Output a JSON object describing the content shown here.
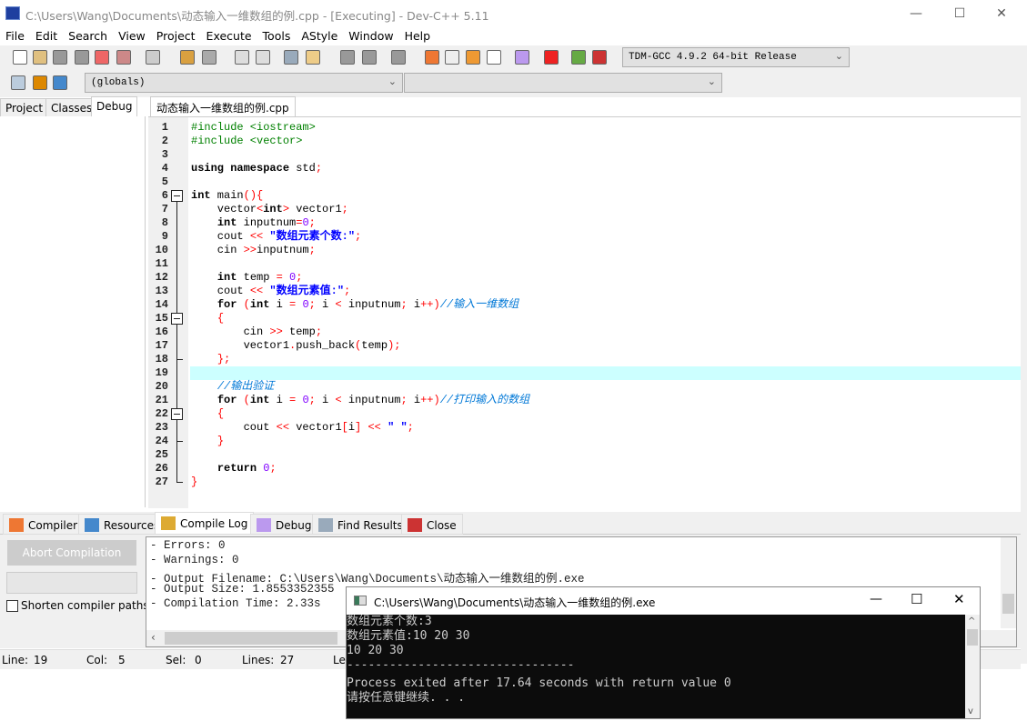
{
  "window": {
    "title": "C:\\Users\\Wang\\Documents\\动态输入一维数组的例.cpp - [Executing] - Dev-C++ 5.11",
    "minimize": "—",
    "maximize": "☐",
    "close": "✕"
  },
  "menu": [
    "File",
    "Edit",
    "Search",
    "View",
    "Project",
    "Execute",
    "Tools",
    "AStyle",
    "Window",
    "Help"
  ],
  "toolbar": {
    "compiler_select": "TDM-GCC 4.9.2 64-bit Release",
    "scope_select": "(globals)",
    "member_select": ""
  },
  "left_tabs": [
    "Project",
    "Classes",
    "Debug"
  ],
  "left_active": "Debug",
  "file_tab": "动态输入一维数组的例.cpp",
  "editor": {
    "current_line": 19,
    "fold_lines": [
      6,
      15,
      22
    ],
    "lines": [
      [
        [
          "#include <iostream>",
          "pp"
        ]
      ],
      [
        [
          "#include <vector>",
          "pp"
        ]
      ],
      [],
      [
        [
          "using namespace",
          "kw"
        ],
        [
          " std",
          "id"
        ],
        [
          ";",
          "sy"
        ]
      ],
      [],
      [
        [
          "int",
          "kw"
        ],
        [
          " main",
          "id"
        ],
        [
          "(){",
          "sy"
        ]
      ],
      [
        [
          "    vector",
          "id"
        ],
        [
          "<",
          "sy"
        ],
        [
          "int",
          "kw"
        ],
        [
          ">",
          "sy"
        ],
        [
          " vector1",
          "id"
        ],
        [
          ";",
          "sy"
        ]
      ],
      [
        [
          "    ",
          "id"
        ],
        [
          "int",
          "kw"
        ],
        [
          " inputnum",
          "id"
        ],
        [
          "=",
          "sy"
        ],
        [
          "0",
          "nu"
        ],
        [
          ";",
          "sy"
        ]
      ],
      [
        [
          "    cout ",
          "id"
        ],
        [
          "<<",
          "sy"
        ],
        [
          " ",
          "id"
        ],
        [
          "\"数组元素个数:\"",
          "st"
        ],
        [
          ";",
          "sy"
        ]
      ],
      [
        [
          "    cin ",
          "id"
        ],
        [
          ">>",
          "sy"
        ],
        [
          "inputnum",
          "id"
        ],
        [
          ";",
          "sy"
        ]
      ],
      [],
      [
        [
          "    ",
          "id"
        ],
        [
          "int",
          "kw"
        ],
        [
          " temp ",
          "id"
        ],
        [
          "=",
          "sy"
        ],
        [
          " ",
          "id"
        ],
        [
          "0",
          "nu"
        ],
        [
          ";",
          "sy"
        ]
      ],
      [
        [
          "    cout ",
          "id"
        ],
        [
          "<<",
          "sy"
        ],
        [
          " ",
          "id"
        ],
        [
          "\"数组元素值:\"",
          "st"
        ],
        [
          ";",
          "sy"
        ]
      ],
      [
        [
          "    ",
          "id"
        ],
        [
          "for",
          "kw"
        ],
        [
          " ",
          "id"
        ],
        [
          "(",
          "sy"
        ],
        [
          "int",
          "kw"
        ],
        [
          " i ",
          "id"
        ],
        [
          "=",
          "sy"
        ],
        [
          " ",
          "id"
        ],
        [
          "0",
          "nu"
        ],
        [
          ";",
          "sy"
        ],
        [
          " i ",
          "id"
        ],
        [
          "<",
          "sy"
        ],
        [
          " inputnum",
          "id"
        ],
        [
          ";",
          "sy"
        ],
        [
          " i",
          "id"
        ],
        [
          "++)",
          "sy"
        ],
        [
          "//输入一维数组",
          "cm"
        ]
      ],
      [
        [
          "    ",
          "id"
        ],
        [
          "{",
          "sy"
        ]
      ],
      [
        [
          "        cin ",
          "id"
        ],
        [
          ">>",
          "sy"
        ],
        [
          " temp",
          "id"
        ],
        [
          ";",
          "sy"
        ]
      ],
      [
        [
          "        vector1",
          "id"
        ],
        [
          ".",
          "sy"
        ],
        [
          "push_back",
          "id"
        ],
        [
          "(",
          "sy"
        ],
        [
          "temp",
          "id"
        ],
        [
          ");",
          "sy"
        ]
      ],
      [
        [
          "    ",
          "id"
        ],
        [
          "};",
          "sy"
        ]
      ],
      [],
      [
        [
          "    ",
          "id"
        ],
        [
          "//输出验证",
          "cm"
        ]
      ],
      [
        [
          "    ",
          "id"
        ],
        [
          "for",
          "kw"
        ],
        [
          " ",
          "id"
        ],
        [
          "(",
          "sy"
        ],
        [
          "int",
          "kw"
        ],
        [
          " i ",
          "id"
        ],
        [
          "=",
          "sy"
        ],
        [
          " ",
          "id"
        ],
        [
          "0",
          "nu"
        ],
        [
          ";",
          "sy"
        ],
        [
          " i ",
          "id"
        ],
        [
          "<",
          "sy"
        ],
        [
          " inputnum",
          "id"
        ],
        [
          ";",
          "sy"
        ],
        [
          " i",
          "id"
        ],
        [
          "++)",
          "sy"
        ],
        [
          "//打印输入的数组",
          "cm"
        ]
      ],
      [
        [
          "    ",
          "id"
        ],
        [
          "{",
          "sy"
        ]
      ],
      [
        [
          "        cout ",
          "id"
        ],
        [
          "<<",
          "sy"
        ],
        [
          " vector1",
          "id"
        ],
        [
          "[",
          "sy"
        ],
        [
          "i",
          "id"
        ],
        [
          "]",
          "sy"
        ],
        [
          " ",
          "id"
        ],
        [
          "<<",
          "sy"
        ],
        [
          " ",
          "id"
        ],
        [
          "\" \"",
          "st"
        ],
        [
          ";",
          "sy"
        ]
      ],
      [
        [
          "    ",
          "id"
        ],
        [
          "}",
          "sy"
        ]
      ],
      [],
      [
        [
          "    ",
          "id"
        ],
        [
          "return",
          "kw"
        ],
        [
          " ",
          "id"
        ],
        [
          "0",
          "nu"
        ],
        [
          ";",
          "sy"
        ]
      ],
      [
        [
          "}",
          "sy"
        ]
      ]
    ]
  },
  "bottom_tabs": [
    "Compiler",
    "Resources",
    "Compile Log",
    "Debug",
    "Find Results",
    "Close"
  ],
  "bottom_active": "Compile Log",
  "compile": {
    "abort_button": "Abort Compilation",
    "shorten_label": "Shorten compiler paths",
    "shorten_checked": false,
    "log": [
      "- Errors: 0",
      "- Warnings: 0",
      "- Output Filename: C:\\Users\\Wang\\Documents\\动态输入一维数组的例.exe",
      "- Output Size: 1.8553352355",
      "- Compilation Time: 2.33s"
    ]
  },
  "status": {
    "line_label": "Line:",
    "line": "19",
    "col_label": "Col:",
    "col": "5",
    "sel_label": "Sel:",
    "sel": "0",
    "lines_label": "Lines:",
    "lines": "27",
    "len_label": "Le"
  },
  "console": {
    "title": "C:\\Users\\Wang\\Documents\\动态输入一维数组的例.exe",
    "lines": [
      "数组元素个数:3",
      "数组元素值:10 20 30",
      "10 20 30",
      "--------------------------------",
      "Process exited after 17.64 seconds with return value 0",
      "请按任意键继续. . ."
    ]
  },
  "colors": {
    "current_line": "#ccffff",
    "keyword": "#000000",
    "preprocessor": "#008000",
    "symbol": "#ff0000",
    "number": "#8000ff",
    "string": "#0000ff",
    "comment": "#0078d7",
    "console_bg": "#0c0c0c"
  }
}
